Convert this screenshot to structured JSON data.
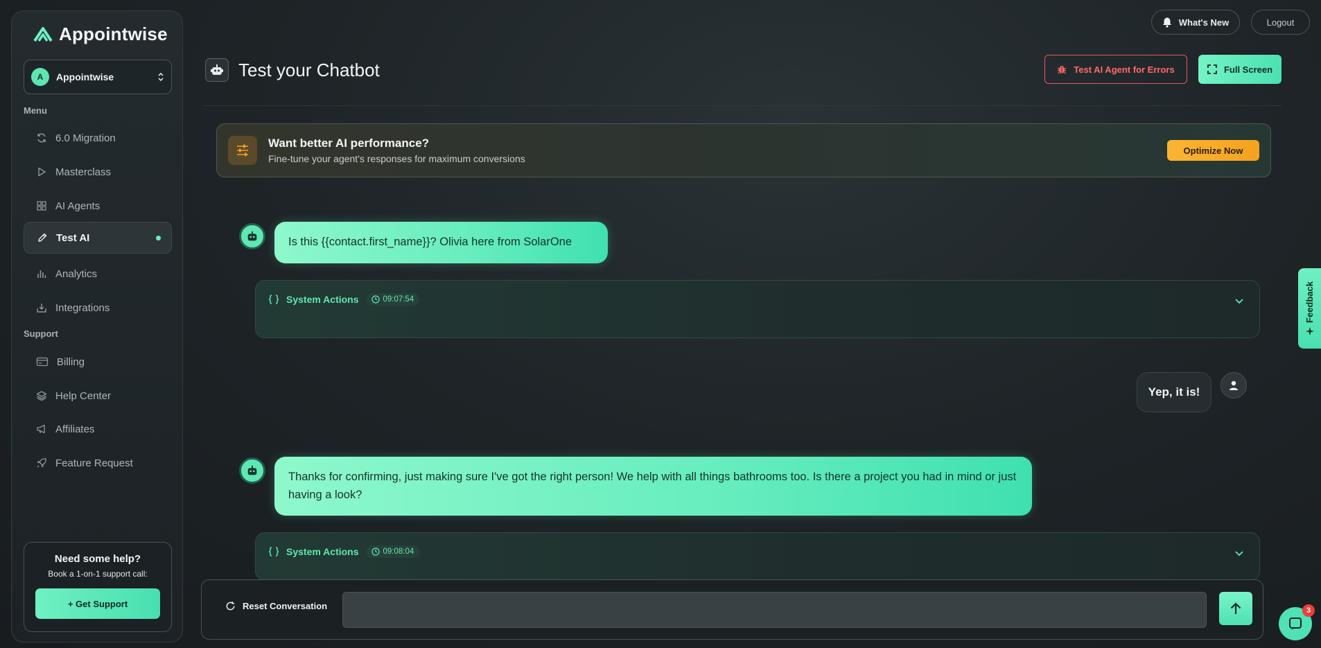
{
  "brand": {
    "name": "Appointwise",
    "logo_icon": "appointwise-logo-icon"
  },
  "workspace": {
    "avatar_letter": "A",
    "name": "Appointwise",
    "icon": "chevron-up-down-icon"
  },
  "sidebar": {
    "menu_label": "Menu",
    "menu_items": [
      {
        "label": "6.0 Migration",
        "icon": "refresh-icon"
      },
      {
        "label": "Masterclass",
        "icon": "play-icon"
      },
      {
        "label": "AI Agents",
        "icon": "grid-icon"
      },
      {
        "label": "Test AI",
        "icon": "pencil-icon",
        "active": true
      },
      {
        "label": "Analytics",
        "icon": "bar-chart-icon"
      },
      {
        "label": "Integrations",
        "icon": "download-icon"
      }
    ],
    "support_label": "Support",
    "support_items": [
      {
        "label": "Billing",
        "icon": "credit-card-icon"
      },
      {
        "label": "Help Center",
        "icon": "layers-icon"
      },
      {
        "label": "Affiliates",
        "icon": "megaphone-icon"
      },
      {
        "label": "Feature Request",
        "icon": "rocket-icon"
      }
    ]
  },
  "help_card": {
    "title": "Need some help?",
    "subtitle": "Book a 1-on-1 support call:",
    "button": "+ Get Support"
  },
  "topbar": {
    "whats_new": "What's New",
    "logout": "Logout"
  },
  "header": {
    "title": "Test your Chatbot",
    "test_errors_button": "Test AI Agent for Errors",
    "full_screen_button": "Full Screen"
  },
  "banner": {
    "title": "Want better AI performance?",
    "subtitle": "Fine-tune your agent's responses for maximum conversions",
    "button": "Optimize Now"
  },
  "chat": {
    "messages": [
      {
        "role": "bot",
        "text": "Is this {{contact.first_name}}? Olivia here from SolarOne"
      },
      {
        "role": "system",
        "label": "System Actions",
        "time": "09:07:54"
      },
      {
        "role": "user",
        "text": "Yep, it is!"
      },
      {
        "role": "bot",
        "text": "Thanks for confirming, just making sure I've got the right person! We help with all things bathrooms too. Is there a project you had in mind or just having a look?"
      },
      {
        "role": "system",
        "label": "System Actions",
        "time": "09:08:04"
      }
    ]
  },
  "input_bar": {
    "reset_label": "Reset Conversation",
    "input_value": "",
    "placeholder": ""
  },
  "feedback_tab": {
    "label": "Feedback"
  },
  "chat_launcher": {
    "badge": "3"
  },
  "colors": {
    "accent": "#5fe8b4",
    "danger": "#ff6b6b",
    "warning": "#f4a21f",
    "background": "#1e2427"
  }
}
